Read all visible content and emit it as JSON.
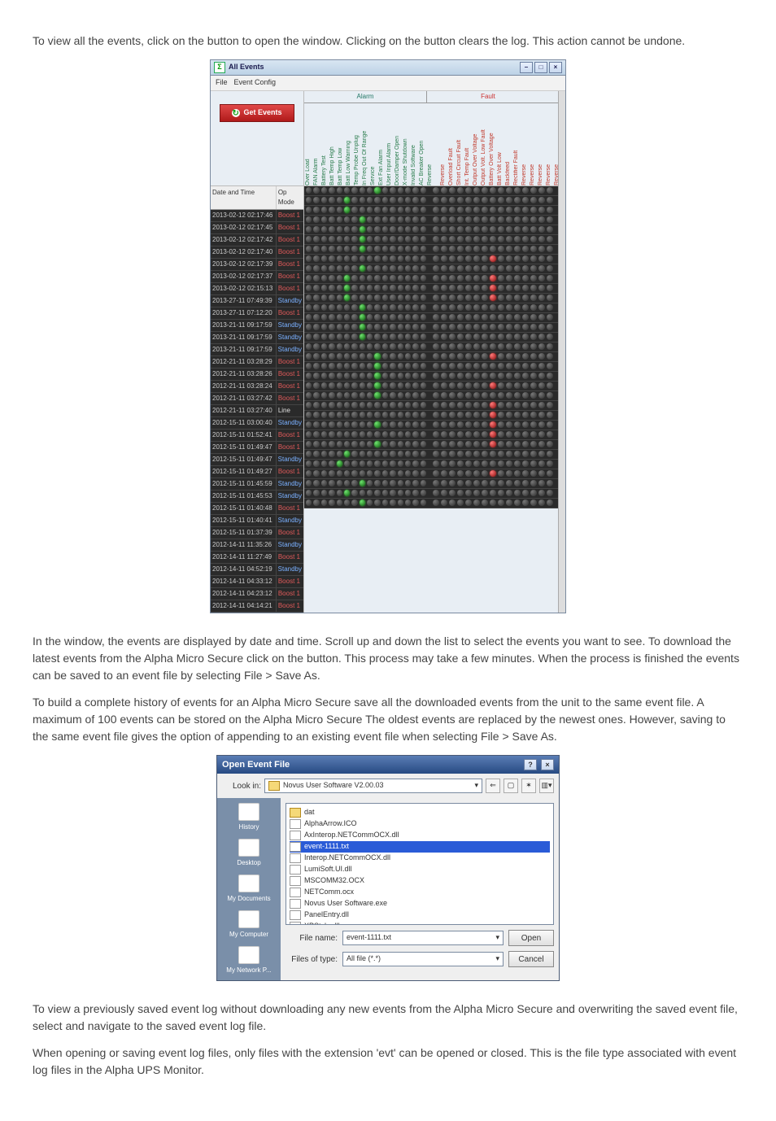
{
  "intro": {
    "p1a": "To view all the events, click on the ",
    "p1b": " button to open the ",
    "p1c": " window. Clicking on the ",
    "p2": " button clears the log. This action cannot be undone."
  },
  "eventsWin": {
    "title": "All Events",
    "menu": {
      "file": "File",
      "config": "Event Config"
    },
    "getEvents": "Get Events",
    "hdr": {
      "alarm": "Alarm",
      "fault": "Fault",
      "dateTime": "Date and Time",
      "opMode": "Op Mode"
    },
    "alarmCols": [
      "Over Load",
      "FAN Alarm",
      "Battery Test",
      "Batt Temp High",
      "Batt Temp Low",
      "Batt Low Warning",
      "Temp Probe Unplug",
      "In Freq Out Of Range",
      "Service",
      "Ext Fan Alarm",
      "User Input Alarm",
      "Door/Damper Open",
      "X-mode Shutdown",
      "Invalid Software",
      "AC Breaker Open",
      "Reverse"
    ],
    "faultCols": [
      "Reverse",
      "Overload Fault",
      "Short Circuit Fault",
      "Int. Temp Fault",
      "Output Over Voltage",
      "Output Volt. Low Fault",
      "Battery Over Voltage",
      "Batt Volt Low",
      "Backfeed",
      "Rectifier Fault",
      "Reverse",
      "Reverse",
      "Reverse",
      "Reverse",
      "Reverse"
    ],
    "rows": [
      {
        "dt": "2013-02-12 02:17:46",
        "mode": "Boost 1",
        "modeClass": "boost",
        "red": -1,
        "grn": 9
      },
      {
        "dt": "2013-02-12 02:17:45",
        "mode": "Boost 1",
        "modeClass": "boost",
        "red": -1,
        "grn": 5
      },
      {
        "dt": "2013-02-12 02:17:42",
        "mode": "Boost 1",
        "modeClass": "boost",
        "red": -1,
        "grn": 5
      },
      {
        "dt": "2013-02-12 02:17:40",
        "mode": "Boost 1",
        "modeClass": "boost",
        "red": -1,
        "grn": 7
      },
      {
        "dt": "2013-02-12 02:17:39",
        "mode": "Boost 1",
        "modeClass": "boost",
        "red": -1,
        "grn": 7
      },
      {
        "dt": "2013-02-12 02:17:37",
        "mode": "Boost 1",
        "modeClass": "boost",
        "red": -1,
        "grn": 7
      },
      {
        "dt": "2013-02-12 02:15:13",
        "mode": "Boost 1",
        "modeClass": "boost",
        "red": -1,
        "grn": 7
      },
      {
        "dt": "2013-27-11 07:49:39",
        "mode": "Standby",
        "modeClass": "standby",
        "red": 7,
        "grn": -1
      },
      {
        "dt": "2013-27-11 07:12:20",
        "mode": "Boost 1",
        "modeClass": "boost",
        "red": -1,
        "grn": 7
      },
      {
        "dt": "2013-21-11 09:17:59",
        "mode": "Standby",
        "modeClass": "standby",
        "red": 7,
        "grn": 5
      },
      {
        "dt": "2013-21-11 09:17:59",
        "mode": "Standby",
        "modeClass": "standby",
        "red": 7,
        "grn": 5
      },
      {
        "dt": "2013-21-11 09:17:59",
        "mode": "Standby",
        "modeClass": "standby",
        "red": 7,
        "grn": 5
      },
      {
        "dt": "2012-21-11 03:28:29",
        "mode": "Boost 1",
        "modeClass": "boost",
        "red": -1,
        "grn": 7
      },
      {
        "dt": "2012-21-11 03:28:26",
        "mode": "Boost 1",
        "modeClass": "boost",
        "red": -1,
        "grn": 7
      },
      {
        "dt": "2012-21-11 03:28:24",
        "mode": "Boost 1",
        "modeClass": "boost",
        "red": -1,
        "grn": 7
      },
      {
        "dt": "2012-21-11 03:27:42",
        "mode": "Boost 1",
        "modeClass": "boost",
        "red": -1,
        "grn": 7
      },
      {
        "dt": "2012-21-11 03:27:40",
        "mode": "Line",
        "modeClass": "line",
        "red": -1,
        "grn": -1
      },
      {
        "dt": "2012-15-11 03:00:40",
        "mode": "Standby",
        "modeClass": "standby",
        "red": 7,
        "grn": 9
      },
      {
        "dt": "2012-15-11 01:52:41",
        "mode": "Boost 1",
        "modeClass": "boost",
        "red": -1,
        "grn": 9
      },
      {
        "dt": "2012-15-11 01:49:47",
        "mode": "Boost 1",
        "modeClass": "boost",
        "red": -1,
        "grn": 9
      },
      {
        "dt": "2012-15-11 01:49:47",
        "mode": "Standby",
        "modeClass": "standby",
        "red": 7,
        "grn": 9
      },
      {
        "dt": "2012-15-11 01:49:27",
        "mode": "Boost 1",
        "modeClass": "boost",
        "red": -1,
        "grn": 9
      },
      {
        "dt": "2012-15-11 01:45:59",
        "mode": "Standby",
        "modeClass": "standby",
        "red": 7,
        "grn": -1
      },
      {
        "dt": "2012-15-11 01:45:53",
        "mode": "Standby",
        "modeClass": "standby",
        "red": 7,
        "grn": -1
      },
      {
        "dt": "2012-15-11 01:40:48",
        "mode": "Boost 1",
        "modeClass": "boost",
        "red": 7,
        "grn": 9
      },
      {
        "dt": "2012-15-11 01:40:41",
        "mode": "Standby",
        "modeClass": "standby",
        "red": 7,
        "grn": -1
      },
      {
        "dt": "2012-15-11 01:37:39",
        "mode": "Boost 1",
        "modeClass": "boost",
        "red": 7,
        "grn": 9
      },
      {
        "dt": "2012-14-11 11:35:26",
        "mode": "Standby",
        "modeClass": "standby",
        "red": -1,
        "grn": 5
      },
      {
        "dt": "2012-14-11 11:27:49",
        "mode": "Boost 1",
        "modeClass": "boost",
        "red": -1,
        "grn": 4
      },
      {
        "dt": "2012-14-11 04:52:19",
        "mode": "Standby",
        "modeClass": "standby",
        "red": 7,
        "grn": -1
      },
      {
        "dt": "2012-14-11 04:33:12",
        "mode": "Boost 1",
        "modeClass": "boost",
        "red": -1,
        "grn": 7
      },
      {
        "dt": "2012-14-11 04:23:12",
        "mode": "Boost 1",
        "modeClass": "boost",
        "red": -1,
        "grn": 5
      },
      {
        "dt": "2012-14-11 04:14:21",
        "mode": "Boost 1",
        "modeClass": "boost",
        "red": -1,
        "grn": 7
      }
    ]
  },
  "mid": {
    "p1a": "In the ",
    "p1b": " window, the events are displayed by date and time. Scroll up and down the list to select the events you want to see. To download the latest events from the Alpha Micro Secure click on the ",
    "p1c": " button. This process may take a few minutes. When the process is finished the events can be saved to an event file by selecting File > Save As.",
    "p2": "To build a complete history of events for an Alpha Micro Secure save all the downloaded events from the unit to the same event file. A maximum of 100 events can be stored on the Alpha Micro Secure The oldest events are replaced by the newest ones. However, saving to the same event file gives the option of appending to an existing event file when selecting File > Save As."
  },
  "dlg": {
    "title": "Open Event File",
    "lookIn": "Look in:",
    "folder": "Novus User Software V2.00.03",
    "places": [
      "History",
      "Desktop",
      "My Documents",
      "My Computer",
      "My Network P..."
    ],
    "files": [
      {
        "name": "dat",
        "cls": "folder"
      },
      {
        "name": "AlphaArrow.ICO",
        "cls": ""
      },
      {
        "name": "AxInterop.NETCommOCX.dll",
        "cls": ""
      },
      {
        "name": "event-1111.txt",
        "cls": "sel"
      },
      {
        "name": "Interop.NETCommOCX.dll",
        "cls": ""
      },
      {
        "name": "LumiSoft.UI.dll",
        "cls": ""
      },
      {
        "name": "MSCOMM32.OCX",
        "cls": ""
      },
      {
        "name": "NETComm.ocx",
        "cls": ""
      },
      {
        "name": "Novus User Software.exe",
        "cls": ""
      },
      {
        "name": "PanelEntry.dll",
        "cls": ""
      },
      {
        "name": "XPStyle.dll",
        "cls": ""
      }
    ],
    "fileNameLabel": "File name:",
    "fileName": "event-1111.txt",
    "fileTypeLabel": "Files of type:",
    "fileType": "All file (*.*)",
    "open": "Open",
    "cancel": "Cancel"
  },
  "outro": {
    "p1a": "To view a previously saved event log without downloading any new events from the Alpha Micro Secure and overwriting the saved event file, select ",
    "p1b": " and navigate to the saved event log file.",
    "p2": "When opening or saving event log files, only files with the extension 'evt' can be opened or closed. This is the file type associated with event log files in the Alpha UPS Monitor."
  }
}
